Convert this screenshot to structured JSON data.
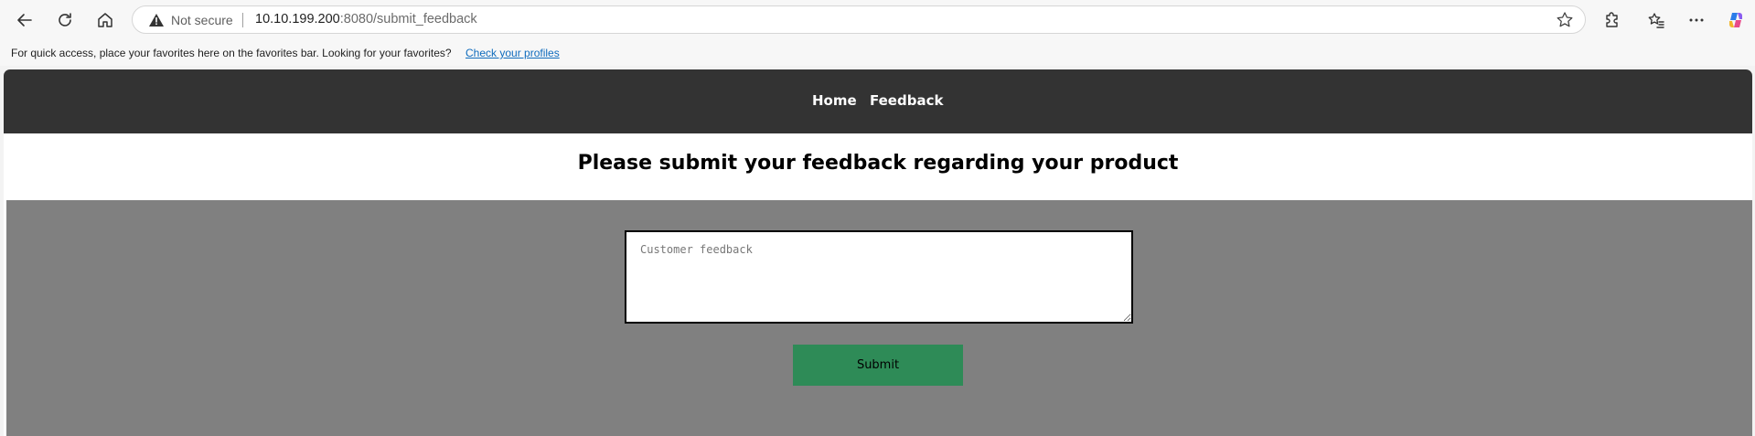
{
  "browser": {
    "address": {
      "security_label": "Not secure",
      "url_host": "10.10.199.200",
      "url_rest": ":8080/submit_feedback"
    },
    "favorites_bar": {
      "message": "For quick access, place your favorites here on the favorites bar. Looking for your favorites?",
      "link": "Check your profiles"
    }
  },
  "nav": {
    "home": "Home",
    "feedback": "Feedback"
  },
  "page": {
    "heading": "Please submit your feedback regarding your product",
    "feedback_placeholder": "Customer feedback",
    "submit_label": "Submit"
  },
  "colors": {
    "nav_bg": "#333333",
    "form_bg": "#808080",
    "submit_bg": "#2e8b57"
  }
}
